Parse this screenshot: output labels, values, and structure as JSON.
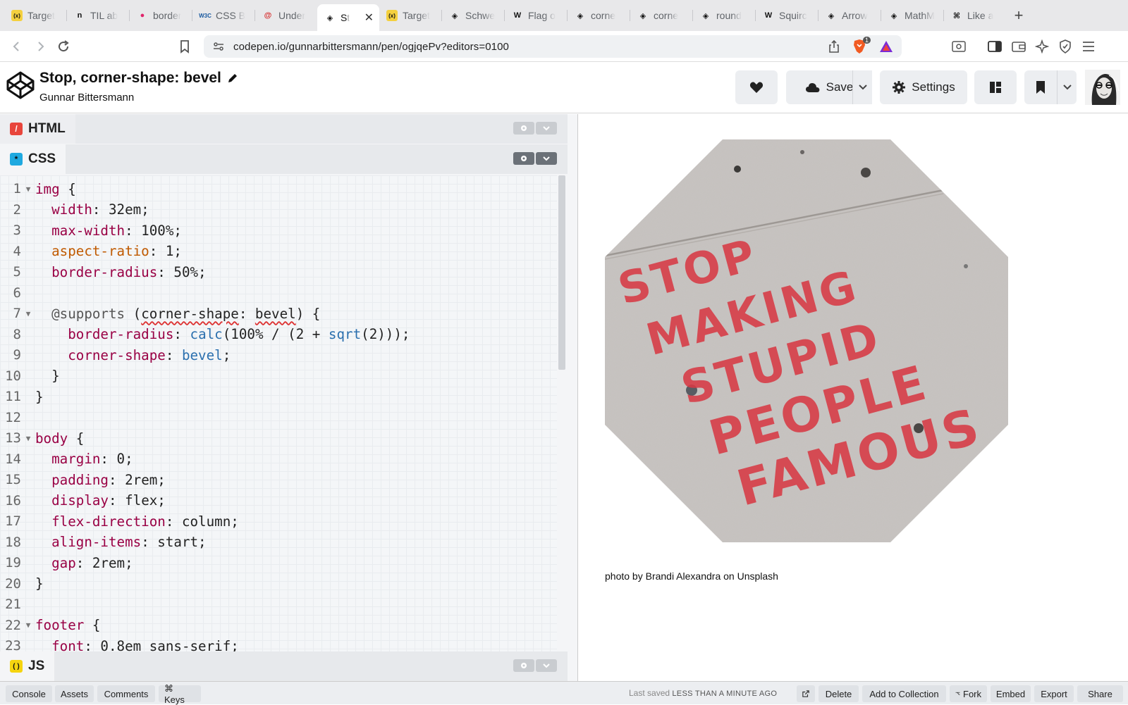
{
  "browser": {
    "tabs": [
      {
        "label": "Target",
        "icon": "x-variable-icon",
        "active": false
      },
      {
        "label": "TIL ab",
        "icon": "notion-icon",
        "active": false
      },
      {
        "label": "border",
        "icon": "pink-circle-icon",
        "active": false
      },
      {
        "label": "CSS B",
        "icon": "w3c-icon",
        "active": false
      },
      {
        "label": "Under",
        "icon": "red-logo-icon",
        "active": false
      },
      {
        "label": "St",
        "icon": "codepen-icon",
        "active": true
      },
      {
        "label": "Target",
        "icon": "x-variable-icon",
        "active": false
      },
      {
        "label": "Schwe",
        "icon": "codepen-icon",
        "active": false
      },
      {
        "label": "Flag o",
        "icon": "wikipedia-icon",
        "active": false
      },
      {
        "label": "corne",
        "icon": "codepen-icon",
        "active": false
      },
      {
        "label": "corne",
        "icon": "codepen-icon",
        "active": false
      },
      {
        "label": "round",
        "icon": "codepen-icon",
        "active": false
      },
      {
        "label": "Squirc",
        "icon": "wikipedia-icon",
        "active": false
      },
      {
        "label": "Arrow",
        "icon": "codepen-icon",
        "active": false
      },
      {
        "label": "MathM",
        "icon": "codepen-icon",
        "active": false
      },
      {
        "label": "Like a",
        "icon": "codepen-alt-icon",
        "active": false
      }
    ],
    "url": "codepen.io/gunnarbittersmann/pen/ogjqePv?editors=0100",
    "extension_badge": "1"
  },
  "pen": {
    "title": "Stop, corner-shape: bevel",
    "author": "Gunnar Bittersmann",
    "save_label": "Save",
    "settings_label": "Settings"
  },
  "panes": {
    "html_label": "HTML",
    "css_label": "CSS",
    "js_label": "JS"
  },
  "code": [
    {
      "n": "1",
      "fold": true,
      "parts": [
        [
          "sel",
          "img"
        ],
        [
          "",
          " {"
        ]
      ]
    },
    {
      "n": "2",
      "fold": false,
      "parts": [
        [
          "",
          "  "
        ],
        [
          "prop",
          "width"
        ],
        [
          "",
          ": 32em;"
        ]
      ]
    },
    {
      "n": "3",
      "fold": false,
      "parts": [
        [
          "",
          "  "
        ],
        [
          "prop",
          "max-width"
        ],
        [
          "",
          ": 100%;"
        ]
      ]
    },
    {
      "n": "4",
      "fold": false,
      "parts": [
        [
          "",
          "  "
        ],
        [
          "prop2",
          "aspect-ratio"
        ],
        [
          "",
          ": 1;"
        ]
      ]
    },
    {
      "n": "5",
      "fold": false,
      "parts": [
        [
          "",
          "  "
        ],
        [
          "prop",
          "border-radius"
        ],
        [
          "",
          ": 50%;"
        ]
      ]
    },
    {
      "n": "6",
      "fold": false,
      "parts": [
        [
          "",
          ""
        ]
      ]
    },
    {
      "n": "7",
      "fold": true,
      "parts": [
        [
          "",
          "  "
        ],
        [
          "at",
          "@supports"
        ],
        [
          "",
          " ("
        ],
        [
          "und",
          "corner-shape"
        ],
        [
          "",
          ": "
        ],
        [
          "und",
          "bevel"
        ],
        [
          "",
          ") {"
        ]
      ]
    },
    {
      "n": "8",
      "fold": false,
      "parts": [
        [
          "",
          "    "
        ],
        [
          "prop",
          "border-radius"
        ],
        [
          "",
          ": "
        ],
        [
          "fn",
          "calc"
        ],
        [
          "",
          "(100% / (2 + "
        ],
        [
          "fn",
          "sqrt"
        ],
        [
          "",
          "(2)));"
        ]
      ]
    },
    {
      "n": "9",
      "fold": false,
      "parts": [
        [
          "",
          "    "
        ],
        [
          "prop",
          "corner-shape"
        ],
        [
          "",
          ": "
        ],
        [
          "fn",
          "bevel"
        ],
        [
          "",
          ";"
        ]
      ]
    },
    {
      "n": "10",
      "fold": false,
      "parts": [
        [
          "",
          "  }"
        ]
      ]
    },
    {
      "n": "11",
      "fold": false,
      "parts": [
        [
          "",
          "}"
        ]
      ]
    },
    {
      "n": "12",
      "fold": false,
      "parts": [
        [
          "",
          ""
        ]
      ]
    },
    {
      "n": "13",
      "fold": true,
      "parts": [
        [
          "sel",
          "body"
        ],
        [
          "",
          " {"
        ]
      ]
    },
    {
      "n": "14",
      "fold": false,
      "parts": [
        [
          "",
          "  "
        ],
        [
          "prop",
          "margin"
        ],
        [
          "",
          ": 0;"
        ]
      ]
    },
    {
      "n": "15",
      "fold": false,
      "parts": [
        [
          "",
          "  "
        ],
        [
          "prop",
          "padding"
        ],
        [
          "",
          ": 2rem;"
        ]
      ]
    },
    {
      "n": "16",
      "fold": false,
      "parts": [
        [
          "",
          "  "
        ],
        [
          "prop",
          "display"
        ],
        [
          "",
          ": flex;"
        ]
      ]
    },
    {
      "n": "17",
      "fold": false,
      "parts": [
        [
          "",
          "  "
        ],
        [
          "prop",
          "flex-direction"
        ],
        [
          "",
          ": column;"
        ]
      ]
    },
    {
      "n": "18",
      "fold": false,
      "parts": [
        [
          "",
          "  "
        ],
        [
          "prop",
          "align-items"
        ],
        [
          "",
          ": start;"
        ]
      ]
    },
    {
      "n": "19",
      "fold": false,
      "parts": [
        [
          "",
          "  "
        ],
        [
          "prop",
          "gap"
        ],
        [
          "",
          ": 2rem;"
        ]
      ]
    },
    {
      "n": "20",
      "fold": false,
      "parts": [
        [
          "",
          "}"
        ]
      ]
    },
    {
      "n": "21",
      "fold": false,
      "parts": [
        [
          "",
          ""
        ]
      ]
    },
    {
      "n": "22",
      "fold": true,
      "parts": [
        [
          "sel",
          "footer"
        ],
        [
          "",
          " {"
        ]
      ]
    },
    {
      "n": "23",
      "fold": false,
      "parts": [
        [
          "",
          "  "
        ],
        [
          "prop",
          "font"
        ],
        [
          "",
          ": 0.8em sans-serif;"
        ]
      ]
    }
  ],
  "result": {
    "stencil_lines": [
      "STOP",
      "MAKING",
      "STUPID",
      "PEOPLE",
      "FAMOUS"
    ],
    "credit": "photo by Brandi Alexandra on Unsplash"
  },
  "bottom": {
    "console": "Console",
    "assets": "Assets",
    "comments": "Comments",
    "keys": "⌘ Keys",
    "last_saved_prefix": "Last saved",
    "last_saved_value": "LESS THAN A MINUTE AGO",
    "delete": "Delete",
    "add_to_collection": "Add to Collection",
    "fork": "Fork",
    "embed": "Embed",
    "export": "Export",
    "share": "Share"
  },
  "colors": {
    "html_icon": "#e8453c",
    "css_icon": "#1fa9e0",
    "js_icon": "#f5d40f",
    "stencil_red": "#d83a45",
    "concrete": "#c6c2bf"
  }
}
